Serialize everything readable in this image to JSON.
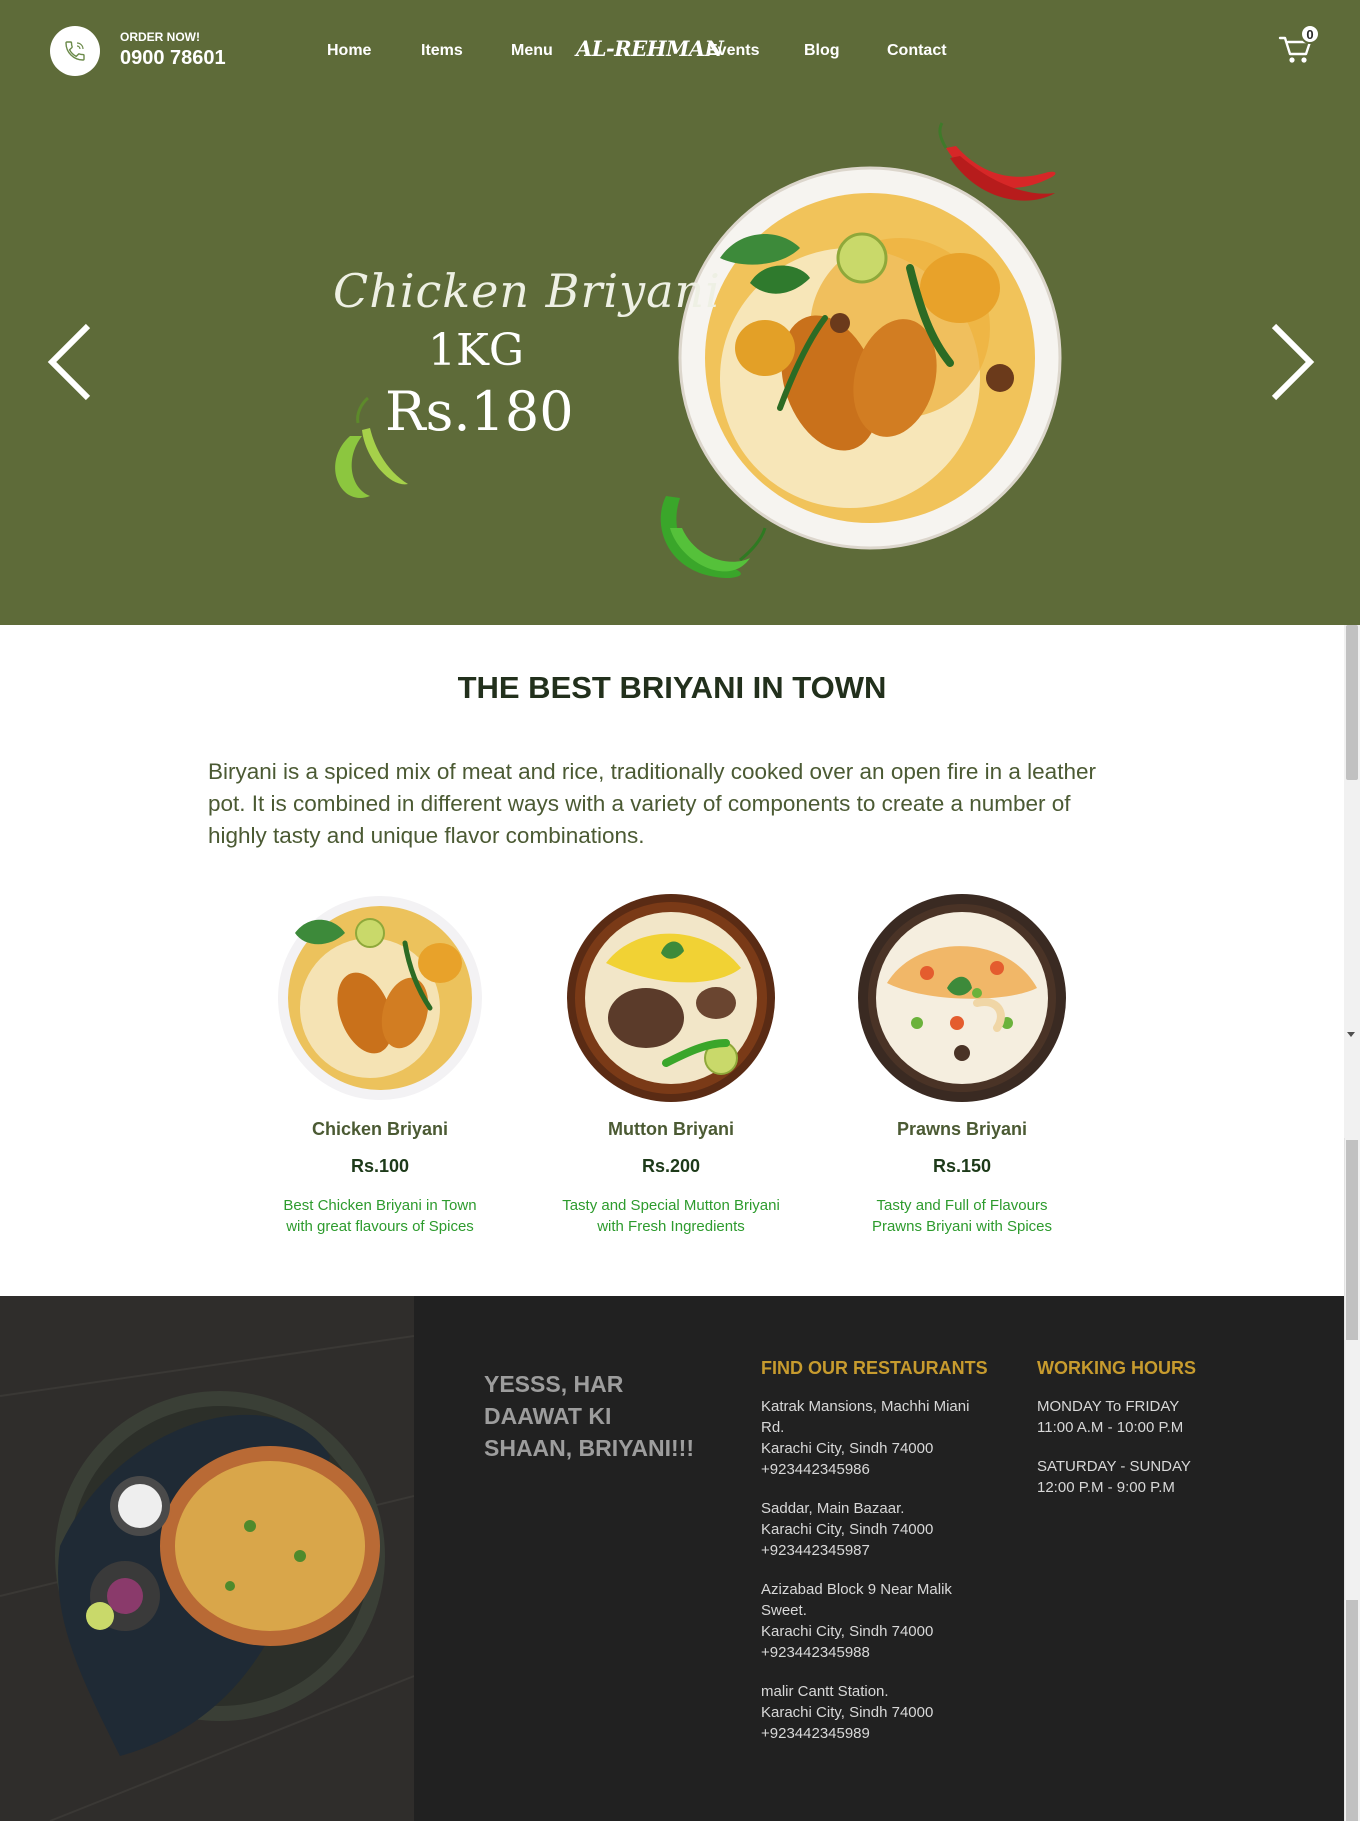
{
  "header": {
    "order_label": "ORDER NOW!",
    "order_phone": "0900 78601",
    "logo_text": "AL-REHMAN",
    "nav": {
      "home": "Home",
      "items": "Items",
      "menu": "Menu",
      "events": "Events",
      "blog": "Blog",
      "contact": "Contact"
    },
    "cart_count": "0"
  },
  "hero": {
    "title": "Chicken Briyani",
    "weight": "1KG",
    "price": "Rs.180"
  },
  "menu_section": {
    "title": "THE BEST BRIYANI IN TOWN",
    "intro": "Biryani is a spiced mix of meat and rice, traditionally cooked over an open fire in a leather pot. It is combined in different ways with a variety of components to create a number of highly tasty and unique flavor combinations.",
    "items": [
      {
        "name": "Chicken Briyani",
        "price": "Rs.100",
        "desc": "Best Chicken Briyani in Town with great flavours of Spices"
      },
      {
        "name": "Mutton Briyani",
        "price": "Rs.200",
        "desc": "Tasty and Special Mutton Briyani with Fresh Ingredients"
      },
      {
        "name": "Prawns Briyani",
        "price": "Rs.150",
        "desc": "Tasty and Full of Flavours Prawns Briyani with Spices"
      }
    ]
  },
  "footer": {
    "slogan": "YESSS, HAR DAAWAT KI SHAAN, BRIYANI!!!",
    "restaurants_heading": "FIND OUR RESTAURANTS",
    "locations": [
      {
        "line1": "Katrak Mansions, Machhi Miani Rd.",
        "line2": "Karachi City, Sindh 74000",
        "phone": "+923442345986"
      },
      {
        "line1": "Saddar, Main Bazaar.",
        "line2": "Karachi City, Sindh 74000",
        "phone": "+923442345987"
      },
      {
        "line1": "Azizabad Block 9 Near Malik Sweet.",
        "line2": "Karachi City, Sindh 74000",
        "phone": "+923442345988"
      },
      {
        "line1": "malir Cantt Station.",
        "line2": "Karachi City, Sindh 74000",
        "phone": "+923442345989"
      }
    ],
    "hours_heading": "WORKING HOURS",
    "hours": [
      {
        "days": "MONDAY To FRIDAY",
        "time": "11:00 A.M - 10:00 P.M"
      },
      {
        "days": "SATURDAY - SUNDAY",
        "time": "12:00 P.M - 9:00 P.M"
      }
    ]
  },
  "colors": {
    "hero_bg": "#5e6b39",
    "heading_dark": "#22301c",
    "accent_green": "#2d9b2d",
    "footer_bg": "#212121",
    "footer_gold": "#c79b2e"
  },
  "icons": {
    "phone": "phone-icon",
    "cart": "shopping-cart-icon",
    "prev": "chevron-left-icon",
    "next": "chevron-right-icon"
  }
}
